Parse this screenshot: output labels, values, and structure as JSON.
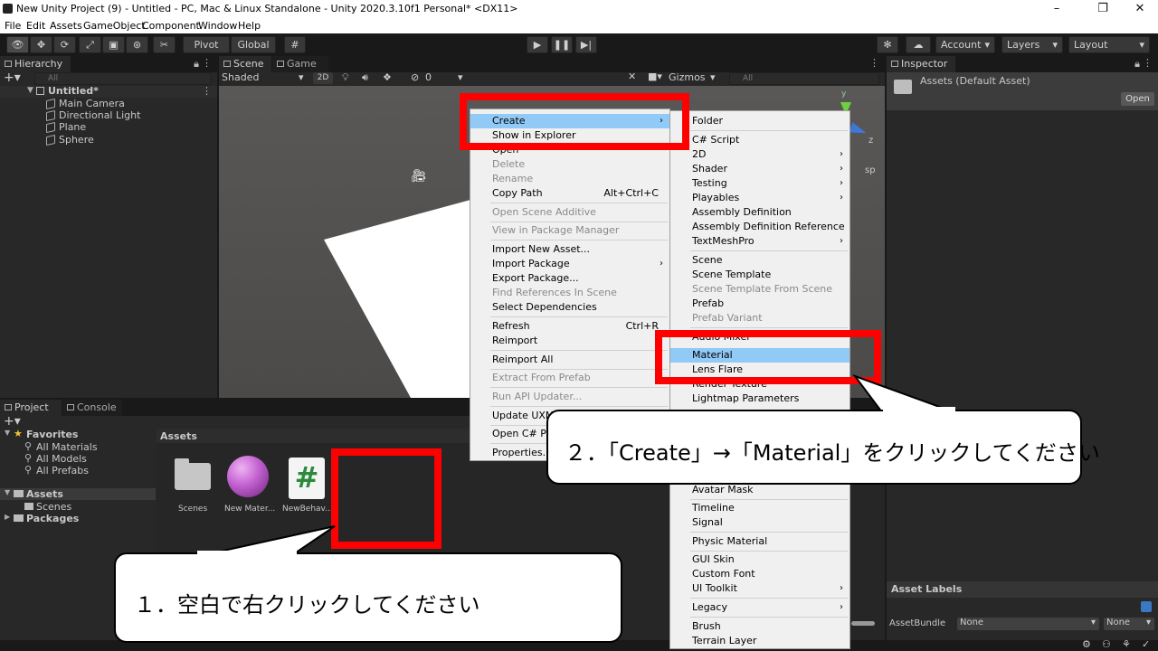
{
  "window": {
    "title": "New Unity Project (9) - Untitled - PC, Mac & Linux Standalone - Unity 2020.3.10f1 Personal* <DX11>",
    "minimize": "–",
    "maximize": "❐",
    "close": "✕"
  },
  "menubar": [
    "File",
    "Edit",
    "Assets",
    "GameObject",
    "Component",
    "Window",
    "Help"
  ],
  "toolbar": {
    "pivot": "Pivot",
    "global": "Global",
    "account": "Account",
    "layers": "Layers",
    "layout": "Layout"
  },
  "hierarchy": {
    "tab": "Hierarchy",
    "search_placeholder": "All",
    "scene": "Untitled*",
    "items": [
      "Main Camera",
      "Directional Light",
      "Plane",
      "Sphere"
    ]
  },
  "scene": {
    "tabs": [
      "Scene",
      "Game"
    ],
    "shading": "Shaded",
    "mode_2d": "2D",
    "hidden_count": "0",
    "gizmos": "Gizmos",
    "search_placeholder": "All",
    "axis_y": "y",
    "axis_z": "z",
    "persp_fragment": "sp"
  },
  "inspector": {
    "tab": "Inspector",
    "asset": "Assets (Default Asset)",
    "open": "Open",
    "asset_labels": "Asset Labels",
    "asset_bundle_label": "AssetBundle",
    "bundle_value": "None",
    "variant_value": "None"
  },
  "project": {
    "tabs": [
      "Project",
      "Console"
    ],
    "favorites_label": "Favorites",
    "favorites": [
      "All Materials",
      "All Models",
      "All Prefabs"
    ],
    "assets_label": "Assets",
    "assets_children": [
      "Scenes"
    ],
    "packages_label": "Packages",
    "breadcrumb": "Assets",
    "grid": [
      {
        "name": "Scenes",
        "type": "folder"
      },
      {
        "name": "New Mater...",
        "type": "material"
      },
      {
        "name": "NewBehav...",
        "type": "script"
      }
    ]
  },
  "context_menu": {
    "items": [
      {
        "label": "Create",
        "arrow": "›",
        "state": "hl"
      },
      {
        "label": "Show in Explorer",
        "state": "normal"
      },
      {
        "label": "Open",
        "state": "normal"
      },
      {
        "label": "Delete",
        "state": "dis"
      },
      {
        "label": "Rename",
        "state": "dis"
      },
      {
        "label": "Copy Path",
        "shortcut": "Alt+Ctrl+C",
        "state": "normal"
      },
      {
        "label": "Open Scene Additive",
        "state": "dis"
      },
      {
        "label": "View in Package Manager",
        "state": "dis"
      },
      {
        "label": "Import New Asset...",
        "state": "normal"
      },
      {
        "label": "Import Package",
        "arrow": "›",
        "state": "normal"
      },
      {
        "label": "Export Package...",
        "state": "normal"
      },
      {
        "label": "Find References In Scene",
        "state": "dis"
      },
      {
        "label": "Select Dependencies",
        "state": "normal"
      },
      {
        "label": "Refresh",
        "shortcut": "Ctrl+R",
        "state": "normal"
      },
      {
        "label": "Reimport",
        "state": "normal"
      },
      {
        "label": "Reimport All",
        "state": "normal"
      },
      {
        "label": "Extract From Prefab",
        "state": "dis"
      },
      {
        "label": "Run API Updater...",
        "state": "dis"
      },
      {
        "label": "Update UXML",
        "state": "normal"
      },
      {
        "label": "Open C# Proj",
        "state": "normal"
      },
      {
        "label": "Properties...",
        "state": "normal"
      }
    ]
  },
  "create_submenu": {
    "items": [
      {
        "label": "Folder",
        "state": "normal"
      },
      {
        "label": "C# Script",
        "state": "normal"
      },
      {
        "label": "2D",
        "arrow": "›",
        "state": "normal"
      },
      {
        "label": "Shader",
        "arrow": "›",
        "state": "normal"
      },
      {
        "label": "Testing",
        "arrow": "›",
        "state": "normal"
      },
      {
        "label": "Playables",
        "arrow": "›",
        "state": "normal"
      },
      {
        "label": "Assembly Definition",
        "state": "normal"
      },
      {
        "label": "Assembly Definition Reference",
        "state": "normal"
      },
      {
        "label": "TextMeshPro",
        "arrow": "›",
        "state": "normal"
      },
      {
        "label": "Scene",
        "state": "normal"
      },
      {
        "label": "Scene Template",
        "state": "normal"
      },
      {
        "label": "Scene Template From Scene",
        "state": "dis"
      },
      {
        "label": "Prefab",
        "state": "normal"
      },
      {
        "label": "Prefab Variant",
        "state": "dis"
      },
      {
        "label": "Audio Mixer",
        "state": "normal"
      },
      {
        "label": "Material",
        "state": "hl"
      },
      {
        "label": "Lens Flare",
        "state": "normal"
      },
      {
        "label": "Render Texture",
        "state": "normal"
      },
      {
        "label": "Lightmap Parameters",
        "state": "normal"
      },
      {
        "label": "Avatar Mask",
        "state": "normal"
      },
      {
        "label": "Timeline",
        "state": "normal"
      },
      {
        "label": "Signal",
        "state": "normal"
      },
      {
        "label": "Physic Material",
        "state": "normal"
      },
      {
        "label": "GUI Skin",
        "state": "normal"
      },
      {
        "label": "Custom Font",
        "state": "normal"
      },
      {
        "label": "UI Toolkit",
        "arrow": "›",
        "state": "normal"
      },
      {
        "label": "Legacy",
        "arrow": "›",
        "state": "normal"
      },
      {
        "label": "Brush",
        "state": "normal"
      },
      {
        "label": "Terrain Layer",
        "state": "normal"
      }
    ]
  },
  "callouts": {
    "step1": "１．空白で右クリックしてください",
    "step2": "２．「Create」→「Material」をクリックしてください"
  }
}
